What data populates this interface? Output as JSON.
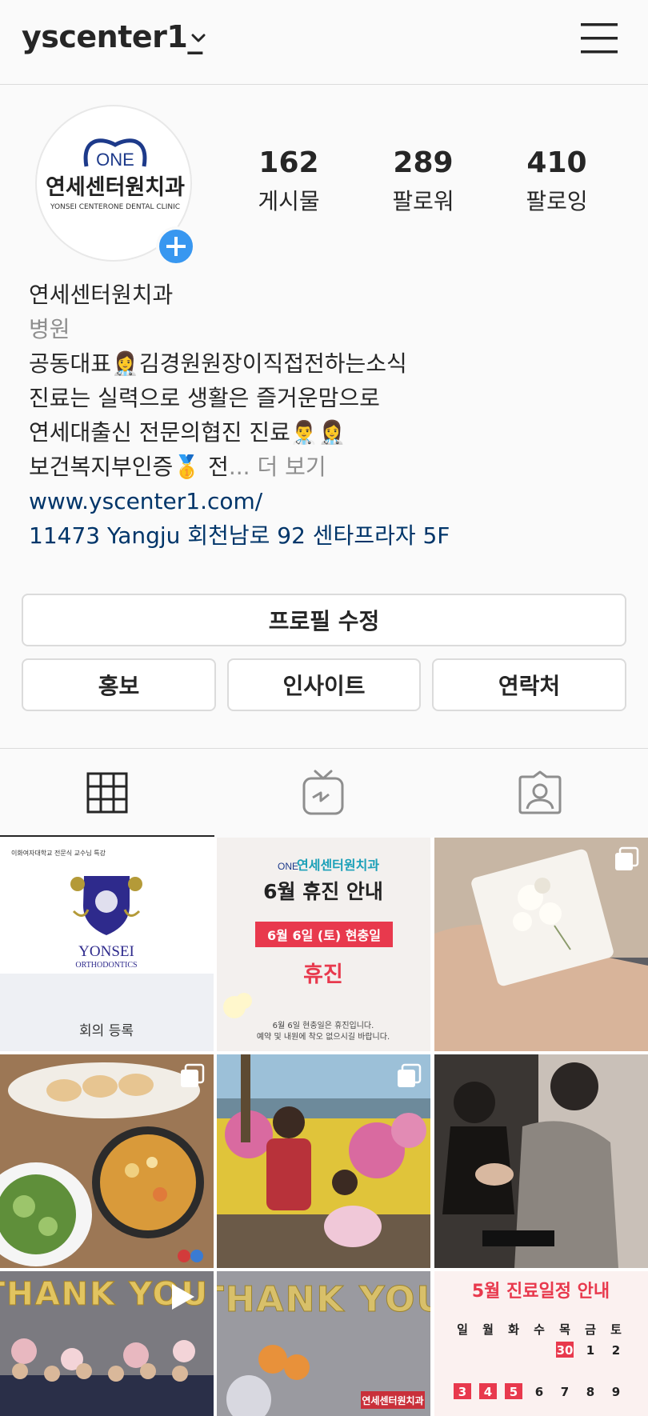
{
  "header": {
    "username": "yscenter1_",
    "chevron_icon": "chevron-down-icon",
    "menu_icon": "hamburger-menu-icon"
  },
  "avatar": {
    "logo_mark": "ONE",
    "logo_name": "연세센터원치과",
    "logo_sub": "YONSEI CENTERONE DENTAL CLINIC",
    "add_story_icon": "plus-icon"
  },
  "stats": [
    {
      "count": "162",
      "label": "게시물"
    },
    {
      "count": "289",
      "label": "팔로워"
    },
    {
      "count": "410",
      "label": "팔로잉"
    }
  ],
  "bio": {
    "name": "연세센터원치과",
    "category": "병원",
    "line1": "공동대표👩‍⚕️김경원원장이직접전하는소식",
    "line2": "진료는 실력으로 생활은 즐거운맘으로",
    "line3": "연세대출신 전문의협진 진료👨‍⚕️👩‍⚕️",
    "line4": "보건복지부인증🥇 전",
    "more": "... 더 보기",
    "website": "www.yscenter1.com/",
    "address": "11473 Yangju 회천남로 92  센타프라자 5F"
  },
  "buttons": {
    "edit_profile": "프로필 수정",
    "promote": "홍보",
    "insights": "인사이트",
    "contact": "연락처"
  },
  "tabs": [
    {
      "icon": "grid-icon",
      "active": true
    },
    {
      "icon": "igtv-icon",
      "active": false
    },
    {
      "icon": "tagged-icon",
      "active": false
    }
  ],
  "posts": {
    "p1": {
      "top_text": "이화여자대학교 전문식 교수님 특강",
      "brand": "YONSEI",
      "brand_sub": "ORTHODONTICS",
      "caption": "회의 등록"
    },
    "p2": {
      "logo_mark": "ONE",
      "logo_name": "연세센터원치과",
      "title": "6월 휴진 안내",
      "date": "6월 6일 (토) 현충일",
      "status": "휴진",
      "note1": "6월 6일 현충일은 휴진입니다.",
      "note2": "예약 및 내원에 착오 없으시길 바랍니다."
    },
    "p7": {
      "balloon_text": "THANK YOU",
      "play_icon": "play-icon"
    },
    "p8": {
      "balloon_text": "THANK YOU",
      "sign_text": "연세센터원치과"
    },
    "p9": {
      "title": "5월 진료일정 안내",
      "days": [
        "일",
        "월",
        "화",
        "수",
        "목",
        "금",
        "토"
      ],
      "row1": [
        "",
        "",
        "",
        "",
        "30",
        "1",
        "2"
      ],
      "row2": [
        "3",
        "4",
        "5",
        "6",
        "7",
        "8",
        "9"
      ]
    }
  },
  "colors": {
    "accent_blue": "#3897f0",
    "link": "#003569",
    "secondary_text": "#8e8e8e",
    "border": "#dbdbdb",
    "calendar_red": "#e8394d"
  }
}
